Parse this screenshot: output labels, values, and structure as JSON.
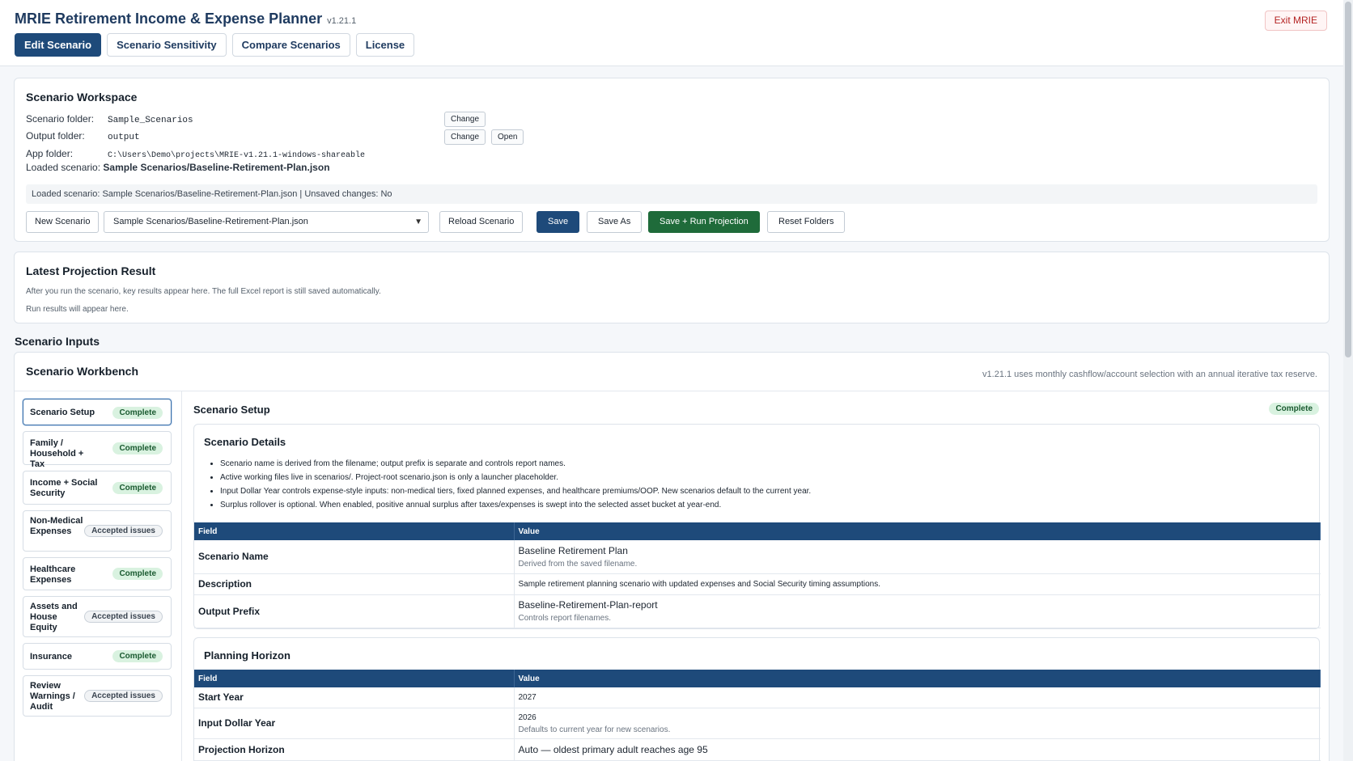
{
  "app": {
    "title": "MRIE Retirement Income & Expense Planner",
    "version": "v1.21.1",
    "exit_label": "Exit MRIE"
  },
  "tabs": [
    {
      "label": "Edit Scenario",
      "active": true
    },
    {
      "label": "Scenario Sensitivity",
      "active": false
    },
    {
      "label": "Compare Scenarios",
      "active": false
    },
    {
      "label": "License",
      "active": false
    }
  ],
  "workspace": {
    "title": "Scenario Workspace",
    "scenario_folder_label": "Scenario folder:",
    "scenario_folder_value": "Sample_Scenarios",
    "output_folder_label": "Output folder:",
    "output_folder_value": "output",
    "app_folder_label": "App folder:",
    "app_folder_value": "C:\\Users\\Demo\\projects\\MRIE-v1.21.1-windows-shareable",
    "loaded_label": "Loaded scenario:",
    "loaded_value": "Sample Scenarios/Baseline-Retirement-Plan.json",
    "change_label": "Change",
    "open_label": "Open",
    "status": "Loaded scenario: Sample Scenarios/Baseline-Retirement-Plan.json | Unsaved changes: No",
    "buttons": {
      "new": "New Scenario",
      "reload": "Reload Scenario",
      "save": "Save",
      "save_as": "Save As",
      "save_run": "Save + Run Projection",
      "reset": "Reset Folders"
    },
    "selected_scenario": "Sample Scenarios/Baseline-Retirement-Plan.json"
  },
  "projection": {
    "title": "Latest Projection Result",
    "line1": "After you run the scenario, key results appear here. The full Excel report is still saved automatically.",
    "line2": "Run results will appear here."
  },
  "inputs_heading": "Scenario Inputs",
  "workbench": {
    "title": "Scenario Workbench",
    "note": "v1.21.1 uses monthly cashflow/account selection with an annual iterative tax reserve.",
    "sidebar": [
      {
        "label": "Scenario Setup",
        "status": "Complete",
        "active": true
      },
      {
        "label": "Family / Household + Tax",
        "status": "Complete"
      },
      {
        "label": "Income + Social Security",
        "status": "Complete"
      },
      {
        "label": "Non-Medical Expenses",
        "status": "Accepted issues"
      },
      {
        "label": "Healthcare Expenses",
        "status": "Complete"
      },
      {
        "label": "Assets and House Equity",
        "status": "Accepted issues"
      },
      {
        "label": "Insurance",
        "status": "Complete"
      },
      {
        "label": "Review Warnings / Audit",
        "status": "Accepted issues"
      }
    ],
    "panel": {
      "title": "Scenario Setup",
      "status": "Complete",
      "details": {
        "title": "Scenario Details",
        "bullets": [
          "Scenario name is derived from the filename; output prefix is separate and controls report names.",
          "Active working files live in scenarios/. Project-root scenario.json is only a launcher placeholder.",
          "Input Dollar Year controls expense-style inputs: non-medical tiers, fixed planned expenses, and healthcare premiums/OOP. New scenarios default to the current year.",
          "Surplus rollover is optional. When enabled, positive annual surplus after taxes/expenses is swept into the selected asset bucket at year-end."
        ],
        "header_field": "Field",
        "header_value": "Value",
        "rows": [
          {
            "field": "Scenario Name",
            "value": "Baseline Retirement Plan",
            "hint": "Derived from the saved filename."
          },
          {
            "field": "Description",
            "value": "Sample retirement planning scenario with updated expenses and Social Security timing assumptions.",
            "hint": ""
          },
          {
            "field": "Output Prefix",
            "value": "Baseline-Retirement-Plan-report",
            "hint": "Controls report filenames."
          }
        ]
      },
      "horizon": {
        "title": "Planning Horizon",
        "header_field": "Field",
        "header_value": "Value",
        "rows": [
          {
            "field": "Start Year",
            "value": "2027",
            "hint": ""
          },
          {
            "field": "Input Dollar Year",
            "value": "2026",
            "hint": "Defaults to current year for new scenarios."
          },
          {
            "field": "Projection Horizon",
            "value": "Auto — oldest primary adult reaches age 95",
            "hint": ""
          }
        ]
      }
    }
  }
}
